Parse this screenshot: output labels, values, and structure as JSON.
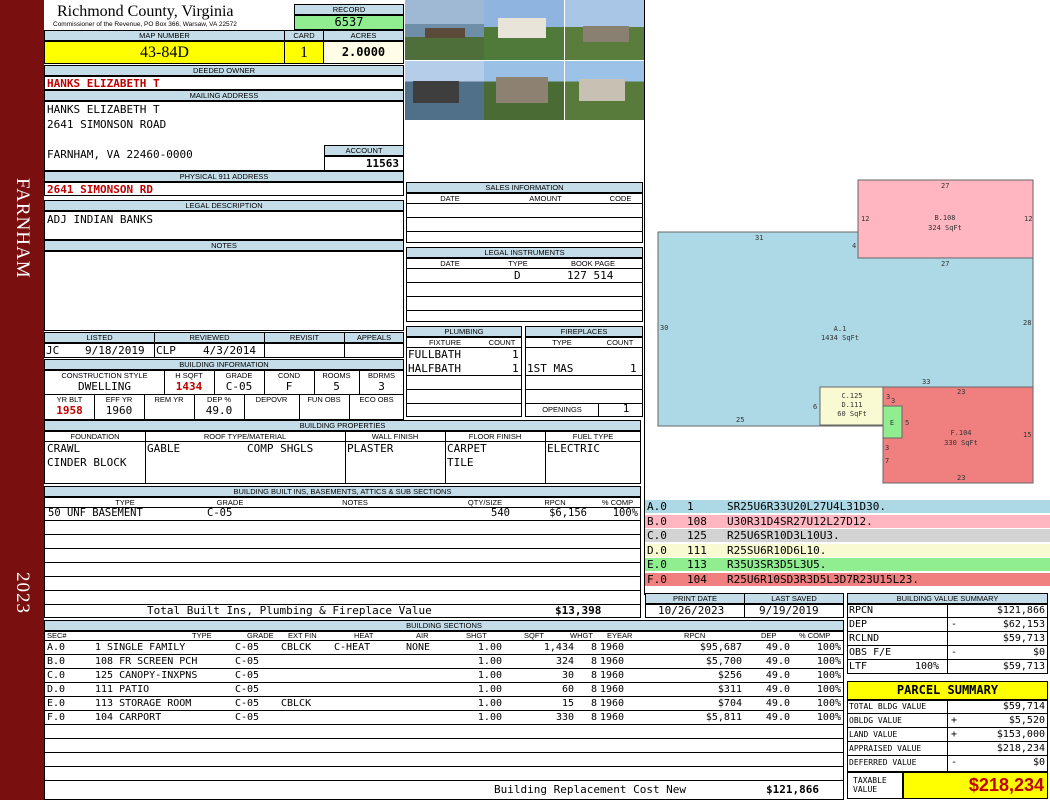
{
  "sidebar": {
    "city": "FARNHAM",
    "year": "2023"
  },
  "header": {
    "county": "Richmond County, Virginia",
    "commissioner": "Commissioner of the Revenue, PO Box 366, Warsaw, VA 22572",
    "record_label": "RECORD",
    "record": "6537",
    "map_label": "MAP NUMBER",
    "map_number": "43-84D",
    "card_label": "CARD",
    "card": "1",
    "acres_label": "ACRES",
    "acres": "2.0000"
  },
  "owner": {
    "label": "DEEDED OWNER",
    "name": "HANKS ELIZABETH T"
  },
  "mailing": {
    "label": "MAILING ADDRESS",
    "line1": "HANKS ELIZABETH T",
    "line2": "2641 SIMONSON ROAD",
    "line3": "FARNHAM, VA 22460-0000"
  },
  "account": {
    "label": "ACCOUNT",
    "value": "11563"
  },
  "physical": {
    "label": "PHYSICAL 911 ADDRESS",
    "value": "2641 SIMONSON RD"
  },
  "legal": {
    "label": "LEGAL DESCRIPTION",
    "value": "ADJ INDIAN BANKS"
  },
  "notes": {
    "label": "NOTES"
  },
  "listed": {
    "listed_label": "LISTED",
    "listed_by": "JC",
    "listed_date": "9/18/2019",
    "reviewed_label": "REVIEWED",
    "reviewed_by": "CLP",
    "reviewed_date": "4/3/2014",
    "revisit_label": "REVISIT",
    "appeals_label": "APPEALS"
  },
  "building_info": {
    "label": "BUILDING INFORMATION",
    "h": {
      "style": "CONSTRUCTION STYLE",
      "hsqft": "H SQFT",
      "grade": "GRADE",
      "cond": "COND",
      "rooms": "ROOMS",
      "bdrms": "BDRMS"
    },
    "style": "DWELLING",
    "hsqft": "1434",
    "grade": "C-05",
    "cond": "F",
    "rooms": "5",
    "bdrms": "3",
    "h2": {
      "yrblt": "YR BLT",
      "effyr": "EFF YR",
      "remyr": "REM YR",
      "dep": "DEP %",
      "depovr": "DEPOVR",
      "funobs": "FUN OBS",
      "ecoobs": "ECO OBS"
    },
    "yrblt": "1958",
    "effyr": "1960",
    "dep": "49.0"
  },
  "sales": {
    "label": "SALES INFORMATION",
    "date": "DATE",
    "amount": "AMOUNT",
    "code": "CODE"
  },
  "legal_inst": {
    "label": "LEGAL INSTRUMENTS",
    "date": "DATE",
    "type": "TYPE",
    "bookpage": "BOOK PAGE",
    "row_type": "D",
    "row_book": "127 514"
  },
  "plumbing": {
    "label": "PLUMBING",
    "fixture": "FIXTURE",
    "count": "COUNT",
    "rows": [
      {
        "f": "FULLBATH",
        "c": "1"
      },
      {
        "f": "HALFBATH",
        "c": "1"
      }
    ]
  },
  "fireplaces": {
    "label": "FIREPLACES",
    "type": "TYPE",
    "count": "COUNT",
    "row_type": "1ST MAS",
    "row_count": "1",
    "openings_label": "OPENINGS",
    "openings": "1"
  },
  "properties": {
    "label": "BUILDING PROPERTIES",
    "foundation_label": "FOUNDATION",
    "roof_label": "ROOF TYPE/MATERIAL",
    "wall_label": "WALL FINISH",
    "floor_label": "FLOOR FINISH",
    "fuel_label": "FUEL TYPE",
    "foundation1": "CRAWL",
    "foundation2": "CINDER BLOCK",
    "roof_type": "GABLE",
    "roof_mat": "COMP SHGLS",
    "wall": "PLASTER",
    "floor1": "CARPET",
    "floor2": "TILE",
    "fuel": "ELECTRIC"
  },
  "builtins": {
    "label": "BUILDING BUILT INS, BASEMENTS, ATTICS & SUB SECTIONS",
    "h": {
      "type": "TYPE",
      "grade": "GRADE",
      "notes": "NOTES",
      "qty": "QTY/SIZE",
      "rpcn": "RPCN",
      "comp": "% COMP"
    },
    "row": {
      "type": "50 UNF BASEMENT",
      "grade": "C-05",
      "qty": "540",
      "rpcn": "$6,156",
      "comp": "100%"
    },
    "total_label": "Total Built Ins, Plumbing & Fireplace Value",
    "total": "$13,398"
  },
  "sketch": {
    "a": {
      "name": "A.1",
      "sqft": "1434 SqFt",
      "top": "31",
      "left": "30",
      "right": "28",
      "bottom": "25",
      "b1": "33",
      "l6": "6",
      "l4": "4"
    },
    "b": {
      "name": "B.108",
      "sqft": "324 SqFt",
      "top": "27",
      "bottom": "27",
      "left": "12",
      "right": "12"
    },
    "c": {
      "name": "C.125",
      "name2": "D.111",
      "sqft": "60 SqFt",
      "l3": "3",
      "l2": "3"
    },
    "e": {
      "name": "E",
      "r": "5",
      "b": "3"
    },
    "f": {
      "name": "F.104",
      "sqft": "330 SqFt",
      "top": "23",
      "bottom": "23",
      "right": "15",
      "left": "7"
    }
  },
  "segments": [
    {
      "id": "A.0",
      "code": "1",
      "desc": "SR25U6R33U20L27U4L31D30.",
      "color": "#add8e6"
    },
    {
      "id": "B.0",
      "code": "108",
      "desc": "U30R31D4SR27U12L27D12.",
      "color": "#ffb6c1"
    },
    {
      "id": "C.0",
      "code": "125",
      "desc": "R25U6SR10D3L10U3.",
      "color": "#d3d3d3"
    },
    {
      "id": "D.0",
      "code": "111",
      "desc": "R25SU6R10D6L10.",
      "color": "#fafad2"
    },
    {
      "id": "E.0",
      "code": "113",
      "desc": "R35U3SR3D5L3U5.",
      "color": "#90ee90"
    },
    {
      "id": "F.0",
      "code": "104",
      "desc": "R25U6R10SD3R3D5L3D7R23U15L23.",
      "color": "#f08080"
    }
  ],
  "print": {
    "print_label": "PRINT DATE",
    "print_date": "10/26/2023",
    "saved_label": "LAST SAVED",
    "saved_date": "9/19/2019"
  },
  "bvs": {
    "label": "BUILDING VALUE SUMMARY",
    "rpcn_label": "RPCN",
    "rpcn": "$121,866",
    "dep_label": "DEP",
    "dep_sign": "-",
    "dep": "$62,153",
    "rclnd_label": "RCLND",
    "rclnd": "$59,713",
    "obs_label": "OBS F/E",
    "obs_sign": "-",
    "obs": "$0",
    "ltf_label": "LTF",
    "ltf_pct": "100%",
    "ltf": "$59,713"
  },
  "parcel": {
    "label": "PARCEL SUMMARY",
    "total_bldg_label": "TOTAL BLDG VALUE",
    "total_bldg": "$59,714",
    "obldg_label": "OBLDG VALUE",
    "obldg_sign": "+",
    "obldg": "$5,520",
    "land_label": "LAND VALUE",
    "land_sign": "+",
    "land": "$153,000",
    "appraised_label": "APPRAISED VALUE",
    "appraised": "$218,234",
    "deferred_label": "DEFERRED VALUE",
    "deferred_sign": "-",
    "deferred": "$0",
    "taxable_label1": "TAXABLE",
    "taxable_label2": "VALUE",
    "taxable": "$218,234"
  },
  "sections": {
    "label": "BUILDING SECTIONS",
    "h": {
      "sec": "SEC#",
      "type": "TYPE",
      "grade": "GRADE",
      "extfin": "EXT FIN",
      "heat": "HEAT",
      "air": "AIR",
      "shgt": "SHGT",
      "sqft": "SQFT",
      "whgt": "WHGT",
      "eyear": "EYEAR",
      "rpcn": "RPCN",
      "dep": "DEP",
      "comp": "% COMP"
    },
    "rows": [
      {
        "sec": "A.0",
        "type": "1 SINGLE FAMILY",
        "grade": "C-05",
        "extfin": "CBLCK",
        "heat": "C-HEAT",
        "air": "NONE",
        "shgt": "1.00",
        "sqft": "1,434",
        "whgt": "8",
        "eyear": "1960",
        "rpcn": "$95,687",
        "dep": "49.0",
        "comp": "100%"
      },
      {
        "sec": "B.0",
        "type": "108 FR SCREEN PCH",
        "grade": "C-05",
        "extfin": "",
        "heat": "",
        "air": "",
        "shgt": "1.00",
        "sqft": "324",
        "whgt": "8",
        "eyear": "1960",
        "rpcn": "$5,700",
        "dep": "49.0",
        "comp": "100%"
      },
      {
        "sec": "C.0",
        "type": "125 CANOPY-INXPNS",
        "grade": "C-05",
        "extfin": "",
        "heat": "",
        "air": "",
        "shgt": "1.00",
        "sqft": "30",
        "whgt": "8",
        "eyear": "1960",
        "rpcn": "$256",
        "dep": "49.0",
        "comp": "100%"
      },
      {
        "sec": "D.0",
        "type": "111 PATIO",
        "grade": "C-05",
        "extfin": "",
        "heat": "",
        "air": "",
        "shgt": "1.00",
        "sqft": "60",
        "whgt": "8",
        "eyear": "1960",
        "rpcn": "$311",
        "dep": "49.0",
        "comp": "100%"
      },
      {
        "sec": "E.0",
        "type": "113 STORAGE ROOM",
        "grade": "C-05",
        "extfin": "CBLCK",
        "heat": "",
        "air": "",
        "shgt": "1.00",
        "sqft": "15",
        "whgt": "8",
        "eyear": "1960",
        "rpcn": "$704",
        "dep": "49.0",
        "comp": "100%"
      },
      {
        "sec": "F.0",
        "type": "104 CARPORT",
        "grade": "C-05",
        "extfin": "",
        "heat": "",
        "air": "",
        "shgt": "1.00",
        "sqft": "330",
        "whgt": "8",
        "eyear": "1960",
        "rpcn": "$5,811",
        "dep": "49.0",
        "comp": "100%"
      }
    ],
    "total_label": "Building Replacement Cost New",
    "total": "$121,866"
  }
}
